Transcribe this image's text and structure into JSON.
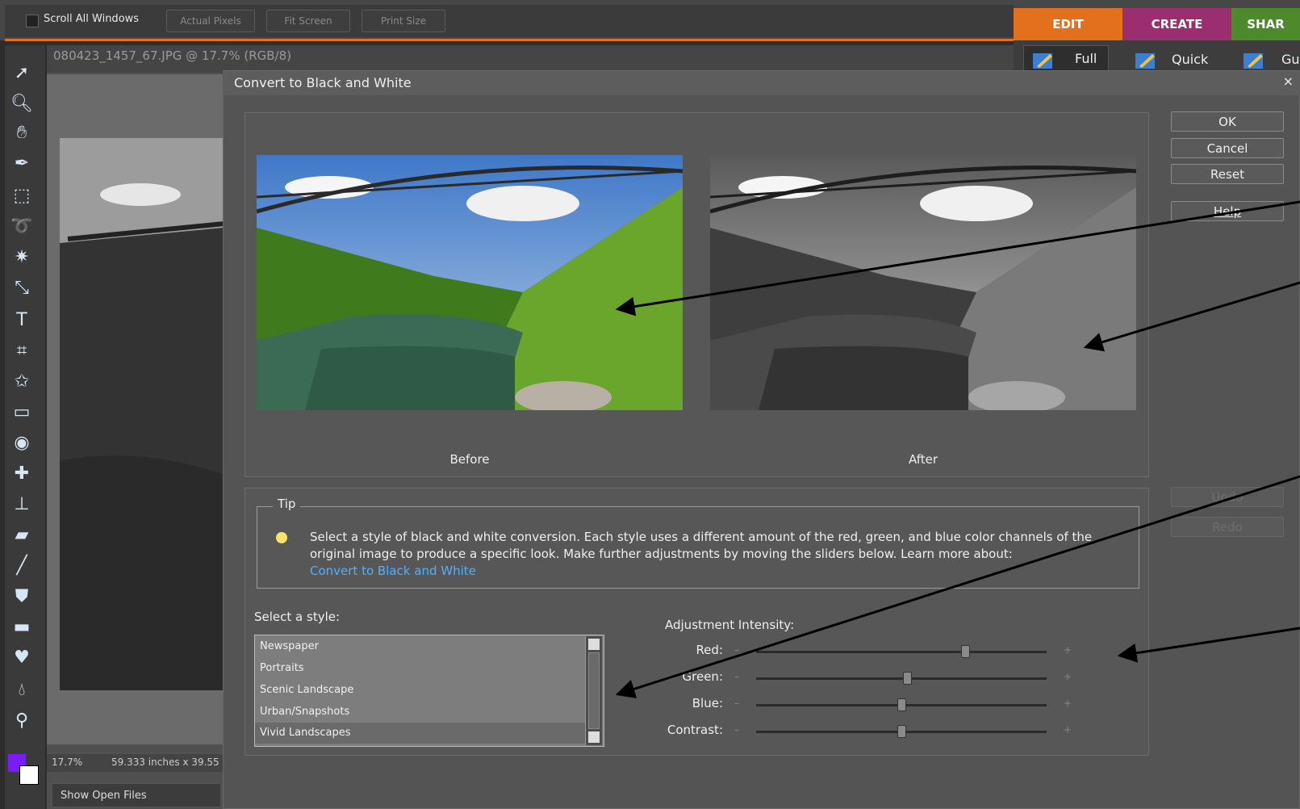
{
  "topbar": {
    "scroll_all": "Scroll All Windows",
    "actual_pixels": "Actual Pixels",
    "fit_screen": "Fit Screen",
    "print_size": "Print Size"
  },
  "mode_tabs": [
    {
      "label": "EDIT",
      "color": "#e2701c"
    },
    {
      "label": "CREATE",
      "color": "#9b2e6e"
    },
    {
      "label": "SHAR",
      "color": "#4c8a2c"
    }
  ],
  "edit_tabs": [
    "Full",
    "Quick",
    "Gu"
  ],
  "document": {
    "title": "080423_1457_67.JPG @ 17.7% (RGB/8)",
    "zoom": "17.7%",
    "size": "59.333 inches x 39.55",
    "show_open_files": "Show Open Files"
  },
  "dialog": {
    "title": "Convert to Black and White",
    "close": "×",
    "before_label": "Before",
    "after_label": "After",
    "buttons": {
      "ok": "OK",
      "cancel": "Cancel",
      "reset": "Reset",
      "help": "Help",
      "undo": "Undo",
      "redo": "Redo"
    },
    "tip": {
      "label": "Tip",
      "text": "Select a style of black and white conversion. Each style uses a different amount of the red, green, and blue color channels of the original image to produce a specific look. Make further adjustments by moving the sliders below. Learn more about:",
      "link": "Convert to Black and White"
    },
    "style_label": "Select a style:",
    "styles": [
      "Newspaper",
      "Portraits",
      "Scenic Landscape",
      "Urban/Snapshots",
      "Vivid Landscapes"
    ],
    "selected_style": "Vivid Landscapes",
    "intensity_label": "Adjustment Intensity:",
    "sliders": [
      {
        "label": "Red:",
        "value": 0.72
      },
      {
        "label": "Green:",
        "value": 0.52
      },
      {
        "label": "Blue:",
        "value": 0.5
      },
      {
        "label": "Contrast:",
        "value": 0.5
      }
    ],
    "minus": "–",
    "plus": "+"
  }
}
